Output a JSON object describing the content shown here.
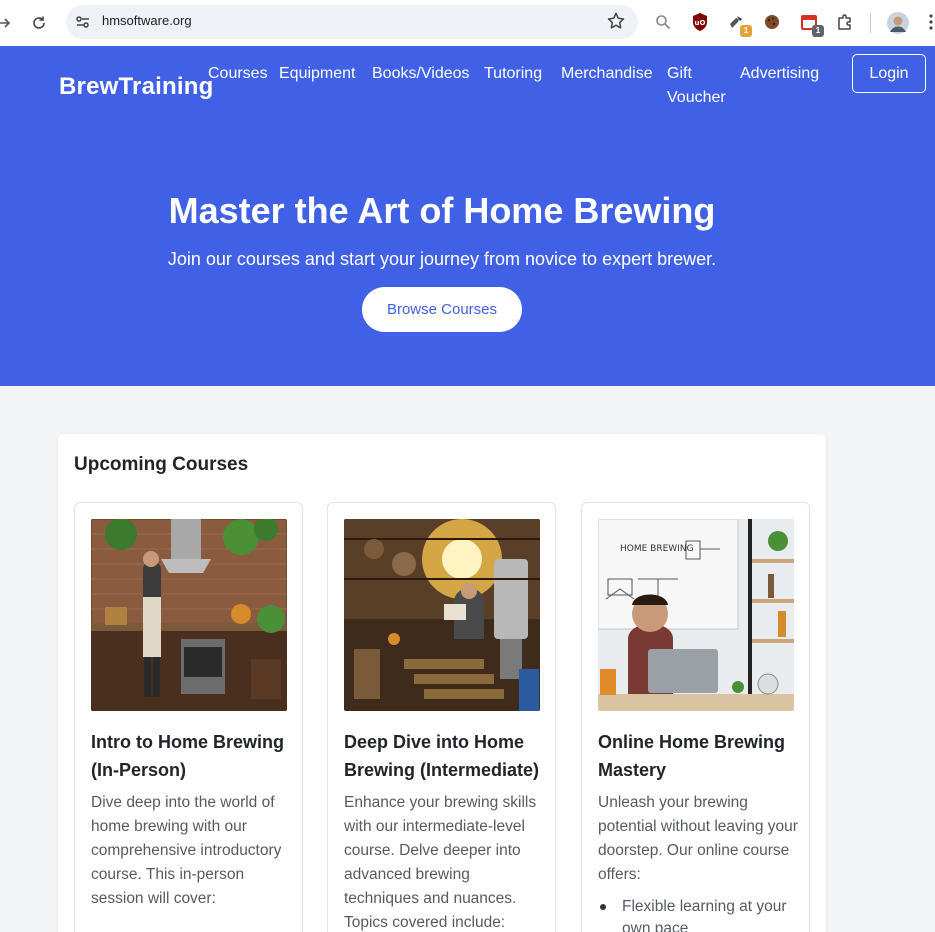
{
  "browser": {
    "url": "hmsoftware.org",
    "extensions": [
      {
        "name": "search-extension-icon"
      },
      {
        "name": "ublock-icon"
      },
      {
        "name": "tools-extension-icon",
        "badge": "1"
      },
      {
        "name": "cookie-extension-icon"
      },
      {
        "name": "calendar-extension-icon",
        "badge": "1"
      },
      {
        "name": "extensions-puzzle-icon"
      },
      {
        "name": "profile-avatar"
      }
    ]
  },
  "site": {
    "brand": "BrewTraining",
    "nav": [
      "Courses",
      "Equipment",
      "Books/Videos",
      "Tutoring",
      "Merchandise",
      "Gift Voucher",
      "Advertising"
    ],
    "nav_gift_line1": "Gift",
    "nav_gift_line2": "Voucher",
    "login_label": "Login"
  },
  "hero": {
    "title": "Master the Art of Home Brewing",
    "subtitle": "Join our courses and start your journey from novice to expert brewer.",
    "cta_label": "Browse Courses"
  },
  "courses": {
    "heading": "Upcoming Courses",
    "items": [
      {
        "title": "Intro to Home Brewing (In-Person)",
        "description": "Dive deep into the world of home brewing with our comprehensive introductory course. This in-person session will cover:"
      },
      {
        "title": "Deep Dive into Home Brewing (Intermediate)",
        "description": "Enhance your brewing skills with our intermediate-level course. Delve deeper into advanced brewing techniques and nuances. Topics covered include:"
      },
      {
        "title": "Online Home Brewing Mastery",
        "description": "Unleash your brewing potential without leaving your doorstep. Our online course offers:",
        "bullets": [
          "Flexible learning at your own pace"
        ]
      }
    ]
  },
  "colors": {
    "header_bg": "#4060e6",
    "page_bg": "#f3f4f6",
    "text_dark": "#212529",
    "text_muted": "#555b61"
  }
}
